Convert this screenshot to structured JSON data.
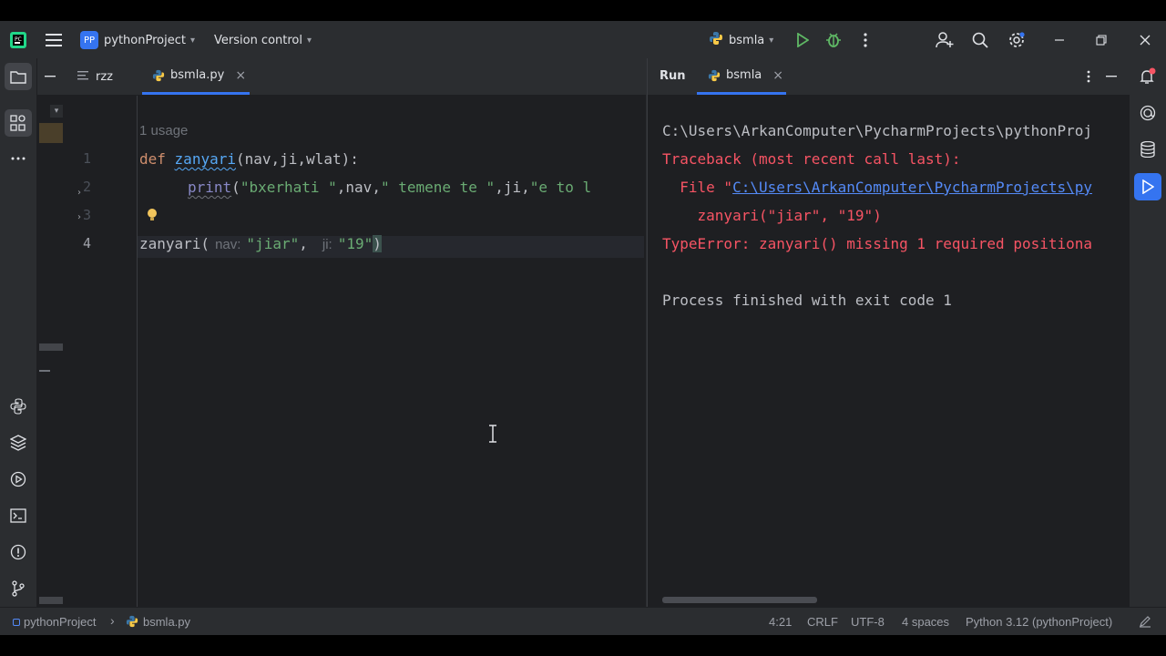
{
  "titlebar": {
    "app_icon": "pycharm-logo",
    "menu_icon": "hamburger-icon",
    "project_badge": "PP",
    "project_name": "pythonProject",
    "vcs_label": "Version control",
    "run_config": "bsmla",
    "icons": [
      "run-icon",
      "debug-icon",
      "more-icon",
      "add-user-icon",
      "search-icon",
      "settings-icon",
      "minimize-icon",
      "restore-icon",
      "close-icon"
    ]
  },
  "editor": {
    "tabs": [
      {
        "label": "rzz",
        "active": false
      },
      {
        "label": "bsmla.py",
        "active": true,
        "close": "×"
      }
    ],
    "usage_hint": "1 usage",
    "line_numbers": [
      "1",
      "2",
      "3",
      "4"
    ],
    "line1": {
      "kw": "def",
      "fn": "zanyari",
      "rest": "(nav,ji,wlat):"
    },
    "line2": {
      "fn": "print",
      "open": "(",
      "s1": "\"bxerhati \"",
      "c1": ",nav,",
      "s2": "\" temene te \"",
      "c2": ",ji,",
      "s3": "\"e to l "
    },
    "line4": {
      "call": "zanyari(",
      "hint1": "nav:",
      "arg1": "\"jiar\"",
      "comma": ",",
      "hint2": "ji:",
      "arg2": "\"19\"",
      "close": ")"
    }
  },
  "run_panel": {
    "title": "Run",
    "tab_label": "bsmla",
    "tab_close": "×",
    "output": {
      "line1": "C:\\Users\\ArkanComputer\\PycharmProjects\\pythonProj",
      "line2": "Traceback (most recent call last):",
      "line3_prefix": "  File \"",
      "line3_link": "C:\\Users\\ArkanComputer\\PycharmProjects\\py",
      "line4": "    zanyari(\"jiar\", \"19\")",
      "line5": "TypeError: zanyari() missing 1 required positiona",
      "line6": "Process finished with exit code 1"
    }
  },
  "statusbar": {
    "breadcrumb_project": "pythonProject",
    "breadcrumb_file": "bsmla.py",
    "position": "4:21",
    "line_sep": "CRLF",
    "encoding": "UTF-8",
    "indent": "4 spaces",
    "interpreter": "Python 3.12 (pythonProject)"
  },
  "colors": {
    "accent": "#3574f0",
    "error": "#f75464",
    "string": "#6aab73",
    "keyword": "#cf8e6d",
    "function": "#56a8f5"
  }
}
